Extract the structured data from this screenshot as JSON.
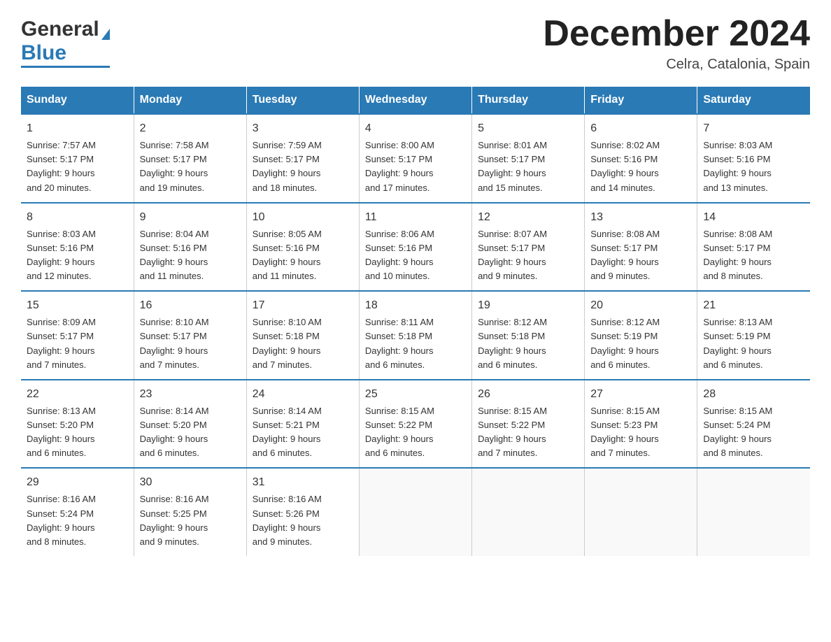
{
  "header": {
    "logo_general": "General",
    "logo_blue": "Blue",
    "month_title": "December 2024",
    "location": "Celra, Catalonia, Spain"
  },
  "days_of_week": [
    "Sunday",
    "Monday",
    "Tuesday",
    "Wednesday",
    "Thursday",
    "Friday",
    "Saturday"
  ],
  "weeks": [
    [
      {
        "num": "1",
        "sunrise": "7:57 AM",
        "sunset": "5:17 PM",
        "daylight": "9 hours and 20 minutes."
      },
      {
        "num": "2",
        "sunrise": "7:58 AM",
        "sunset": "5:17 PM",
        "daylight": "9 hours and 19 minutes."
      },
      {
        "num": "3",
        "sunrise": "7:59 AM",
        "sunset": "5:17 PM",
        "daylight": "9 hours and 18 minutes."
      },
      {
        "num": "4",
        "sunrise": "8:00 AM",
        "sunset": "5:17 PM",
        "daylight": "9 hours and 17 minutes."
      },
      {
        "num": "5",
        "sunrise": "8:01 AM",
        "sunset": "5:17 PM",
        "daylight": "9 hours and 15 minutes."
      },
      {
        "num": "6",
        "sunrise": "8:02 AM",
        "sunset": "5:16 PM",
        "daylight": "9 hours and 14 minutes."
      },
      {
        "num": "7",
        "sunrise": "8:03 AM",
        "sunset": "5:16 PM",
        "daylight": "9 hours and 13 minutes."
      }
    ],
    [
      {
        "num": "8",
        "sunrise": "8:03 AM",
        "sunset": "5:16 PM",
        "daylight": "9 hours and 12 minutes."
      },
      {
        "num": "9",
        "sunrise": "8:04 AM",
        "sunset": "5:16 PM",
        "daylight": "9 hours and 11 minutes."
      },
      {
        "num": "10",
        "sunrise": "8:05 AM",
        "sunset": "5:16 PM",
        "daylight": "9 hours and 11 minutes."
      },
      {
        "num": "11",
        "sunrise": "8:06 AM",
        "sunset": "5:16 PM",
        "daylight": "9 hours and 10 minutes."
      },
      {
        "num": "12",
        "sunrise": "8:07 AM",
        "sunset": "5:17 PM",
        "daylight": "9 hours and 9 minutes."
      },
      {
        "num": "13",
        "sunrise": "8:08 AM",
        "sunset": "5:17 PM",
        "daylight": "9 hours and 9 minutes."
      },
      {
        "num": "14",
        "sunrise": "8:08 AM",
        "sunset": "5:17 PM",
        "daylight": "9 hours and 8 minutes."
      }
    ],
    [
      {
        "num": "15",
        "sunrise": "8:09 AM",
        "sunset": "5:17 PM",
        "daylight": "9 hours and 7 minutes."
      },
      {
        "num": "16",
        "sunrise": "8:10 AM",
        "sunset": "5:17 PM",
        "daylight": "9 hours and 7 minutes."
      },
      {
        "num": "17",
        "sunrise": "8:10 AM",
        "sunset": "5:18 PM",
        "daylight": "9 hours and 7 minutes."
      },
      {
        "num": "18",
        "sunrise": "8:11 AM",
        "sunset": "5:18 PM",
        "daylight": "9 hours and 6 minutes."
      },
      {
        "num": "19",
        "sunrise": "8:12 AM",
        "sunset": "5:18 PM",
        "daylight": "9 hours and 6 minutes."
      },
      {
        "num": "20",
        "sunrise": "8:12 AM",
        "sunset": "5:19 PM",
        "daylight": "9 hours and 6 minutes."
      },
      {
        "num": "21",
        "sunrise": "8:13 AM",
        "sunset": "5:19 PM",
        "daylight": "9 hours and 6 minutes."
      }
    ],
    [
      {
        "num": "22",
        "sunrise": "8:13 AM",
        "sunset": "5:20 PM",
        "daylight": "9 hours and 6 minutes."
      },
      {
        "num": "23",
        "sunrise": "8:14 AM",
        "sunset": "5:20 PM",
        "daylight": "9 hours and 6 minutes."
      },
      {
        "num": "24",
        "sunrise": "8:14 AM",
        "sunset": "5:21 PM",
        "daylight": "9 hours and 6 minutes."
      },
      {
        "num": "25",
        "sunrise": "8:15 AM",
        "sunset": "5:22 PM",
        "daylight": "9 hours and 6 minutes."
      },
      {
        "num": "26",
        "sunrise": "8:15 AM",
        "sunset": "5:22 PM",
        "daylight": "9 hours and 7 minutes."
      },
      {
        "num": "27",
        "sunrise": "8:15 AM",
        "sunset": "5:23 PM",
        "daylight": "9 hours and 7 minutes."
      },
      {
        "num": "28",
        "sunrise": "8:15 AM",
        "sunset": "5:24 PM",
        "daylight": "9 hours and 8 minutes."
      }
    ],
    [
      {
        "num": "29",
        "sunrise": "8:16 AM",
        "sunset": "5:24 PM",
        "daylight": "9 hours and 8 minutes."
      },
      {
        "num": "30",
        "sunrise": "8:16 AM",
        "sunset": "5:25 PM",
        "daylight": "9 hours and 9 minutes."
      },
      {
        "num": "31",
        "sunrise": "8:16 AM",
        "sunset": "5:26 PM",
        "daylight": "9 hours and 9 minutes."
      },
      null,
      null,
      null,
      null
    ]
  ],
  "labels": {
    "sunrise": "Sunrise:",
    "sunset": "Sunset:",
    "daylight": "Daylight:"
  }
}
